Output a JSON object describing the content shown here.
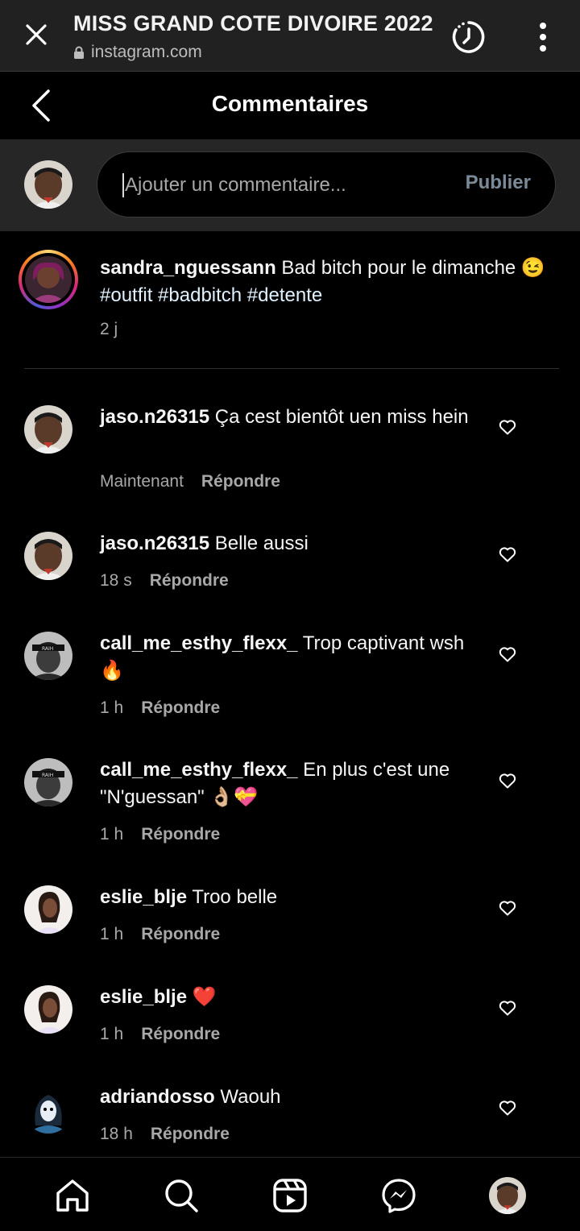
{
  "browser": {
    "title": "MISS GRAND COTE DIVOIRE 2022",
    "url": "instagram.com"
  },
  "header": {
    "title": "Commentaires"
  },
  "composer": {
    "placeholder": "Ajouter un commentaire...",
    "publish_label": "Publier"
  },
  "caption": {
    "username": "sandra_nguessann",
    "text_before": " Bad bitch pour le dimanche 😉 ",
    "hashtags": "#outfit #badbitch #detente",
    "age": "2 j"
  },
  "comments": [
    {
      "username": "jaso.n26315",
      "text": " Ça cest bientôt uen miss hein",
      "time": "Maintenant",
      "reply": "Répondre"
    },
    {
      "username": "jaso.n26315",
      "text": " Belle aussi",
      "time": "18 s",
      "reply": "Répondre"
    },
    {
      "username": "call_me_esthy_flexx_",
      "text": " Trop captivant wsh🔥",
      "time": "1 h",
      "reply": "Répondre"
    },
    {
      "username": "call_me_esthy_flexx_",
      "text": " En plus c'est une \"N'guessan\" 👌🏼💝",
      "time": "1 h",
      "reply": "Répondre"
    },
    {
      "username": "eslie_blje",
      "text": " Troo belle",
      "time": "1 h",
      "reply": "Répondre"
    },
    {
      "username": "eslie_blje",
      "text": " ❤️",
      "time": "1 h",
      "reply": "Répondre"
    },
    {
      "username": "adriandosso",
      "text": " Waouh",
      "time": "18 h",
      "reply": "Répondre"
    }
  ],
  "bottom_nav": [
    "home-icon",
    "search-icon",
    "reels-icon",
    "messenger-icon",
    "profile-avatar"
  ],
  "colors": {
    "background": "#000000",
    "surface": "#262626",
    "publish_disabled": "#7a8a99",
    "hashtag": "#e0f1ff",
    "secondary_text": "#a8a8a8"
  }
}
